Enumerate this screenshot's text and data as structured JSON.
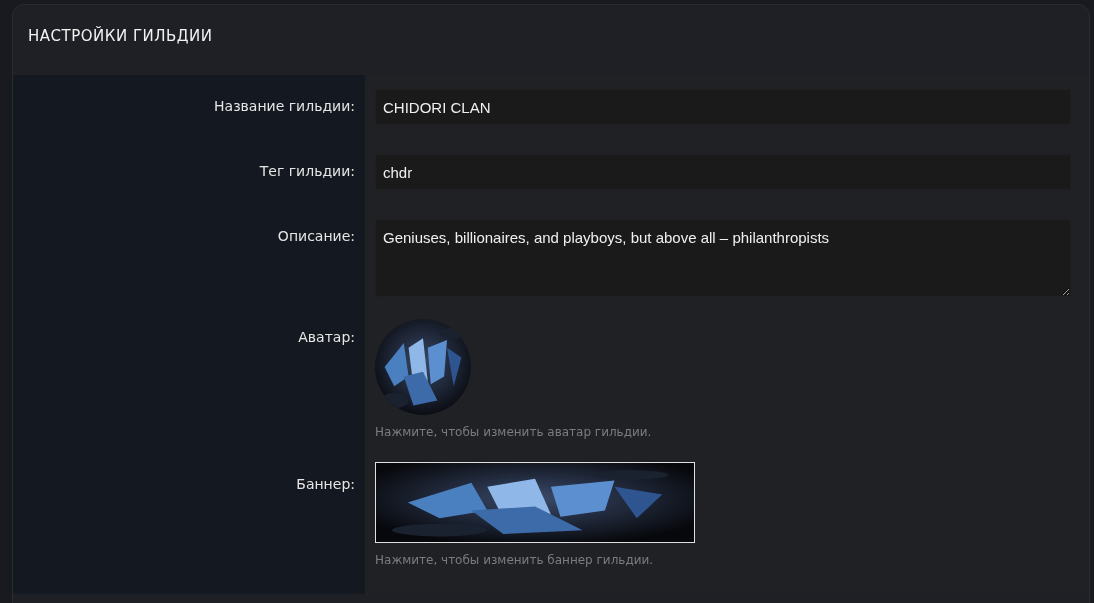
{
  "title": "НАСТРОЙКИ ГИЛЬДИИ",
  "fields": [
    {
      "kind": "text",
      "label": "Название гильдии:",
      "value": "CHIDORI CLAN"
    },
    {
      "kind": "text",
      "label": "Тег гильдии:",
      "value": "chdr"
    },
    {
      "kind": "textarea",
      "label": "Описание:",
      "value": "Geniuses, billionaires, and playboys, but above all – philanthropists"
    },
    {
      "kind": "avatar",
      "label": "Аватар:",
      "hint": "Нажмите, чтобы изменить аватар гильдии."
    },
    {
      "kind": "banner",
      "label": "Баннер:",
      "hint": "Нажмите, чтобы изменить баннер гильдии."
    }
  ]
}
